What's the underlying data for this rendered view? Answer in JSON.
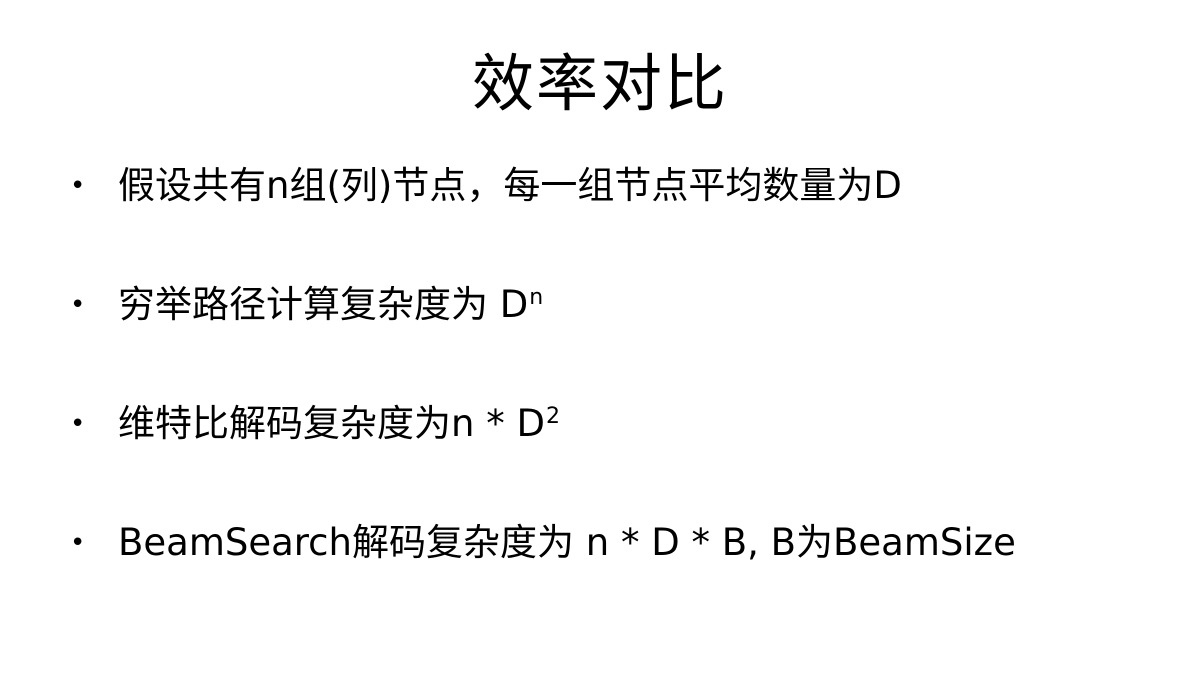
{
  "title": "效率对比",
  "bullet_symbol": "•",
  "bullets": [
    {
      "text": "假设共有n组(列)节点，每一组节点平均数量为D",
      "sup": ""
    },
    {
      "text": "穷举路径计算复杂度为 D",
      "sup": "n"
    },
    {
      "text": "维特比解码复杂度为n * D",
      "sup": "2"
    },
    {
      "text": "BeamSearch解码复杂度为 n * D * B,  B为BeamSize",
      "sup": ""
    }
  ]
}
